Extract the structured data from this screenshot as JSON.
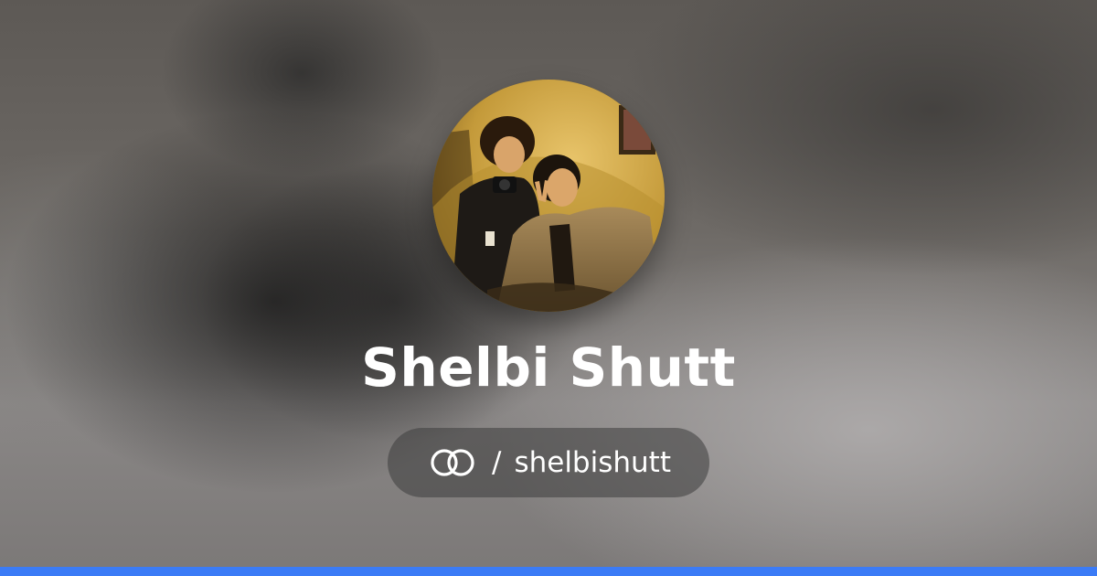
{
  "profile": {
    "name": "Shelbi Shutt",
    "handle_separator": "/",
    "handle": "shelbishutt",
    "avatar_icon": "profile-photo",
    "logo_icon": "linked-rings-logo-icon"
  },
  "colors": {
    "text": "#ffffff",
    "pill_background": "rgba(60,60,60,0.55)",
    "accent_bar": "#3b7bf6",
    "avatar_tone": "#c9a042"
  }
}
